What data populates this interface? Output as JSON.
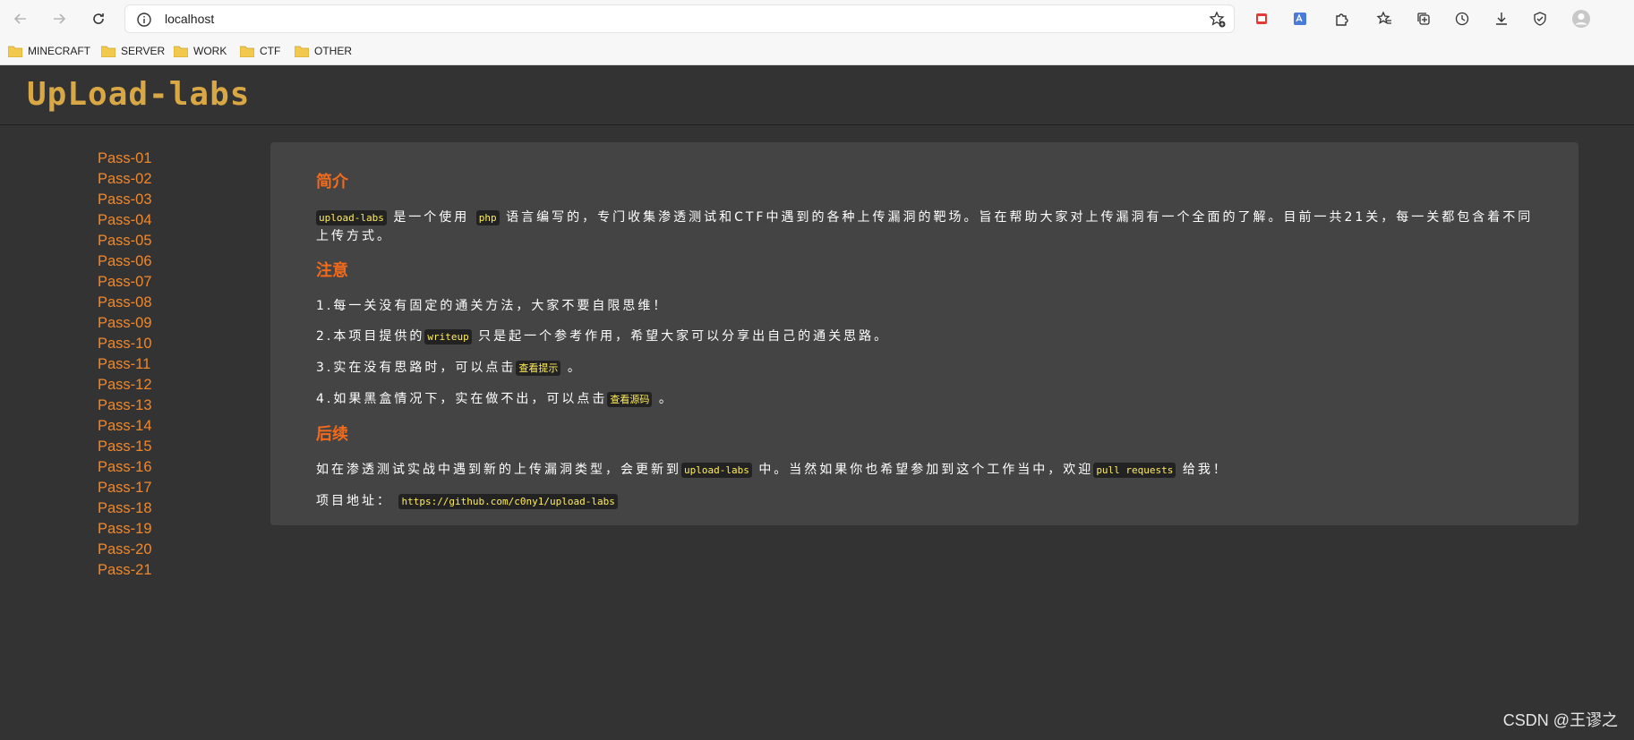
{
  "browser": {
    "url": "localhost",
    "bookmarks": [
      "MINECRAFT",
      "SERVER",
      "WORK",
      "CTF",
      "OTHER"
    ]
  },
  "page": {
    "logo": "UpLoad-labs",
    "sidebar": [
      "Pass-01",
      "Pass-02",
      "Pass-03",
      "Pass-04",
      "Pass-05",
      "Pass-06",
      "Pass-07",
      "Pass-08",
      "Pass-09",
      "Pass-10",
      "Pass-11",
      "Pass-12",
      "Pass-13",
      "Pass-14",
      "Pass-15",
      "Pass-16",
      "Pass-17",
      "Pass-18",
      "Pass-19",
      "Pass-20",
      "Pass-21"
    ],
    "intro": {
      "heading": "简介",
      "code1": "upload-labs",
      "t1": "是一个使用",
      "code2": "php",
      "t2": "语言编写的，专门收集渗透测试和CTF中遇到的各种上传漏洞的靶场。旨在帮助大家对上传漏洞有一个全面的了解。目前一共21关，每一关都包含着不同上传方式。"
    },
    "notice": {
      "heading": "注意",
      "l1": "1.每一关没有固定的通关方法，大家不要自限思维！",
      "l2a": "2.本项目提供的",
      "l2code": "writeup",
      "l2b": "只是起一个参考作用，希望大家可以分享出自己的通关思路。",
      "l3a": "3.实在没有思路时，可以点击",
      "l3code": "查看提示",
      "l3b": "。",
      "l4a": "4.如果黑盒情况下，实在做不出，可以点击",
      "l4code": "查看源码",
      "l4b": "。"
    },
    "follow": {
      "heading": "后续",
      "l1a": "如在渗透测试实战中遇到新的上传漏洞类型，会更新到",
      "l1code": "upload-labs",
      "l1b": "中。当然如果你也希望参加到这个工作当中，欢迎",
      "l1code2": "pull requests",
      "l1c": "给我！",
      "l2a": "项目地址：",
      "l2code": "https://github.com/c0ny1/upload-labs"
    }
  },
  "watermark": "CSDN @王谬之",
  "colors": {
    "accent": "#f26a1b",
    "link": "#f0882b",
    "logo": "#d9a845",
    "code": "#ffed5a"
  }
}
